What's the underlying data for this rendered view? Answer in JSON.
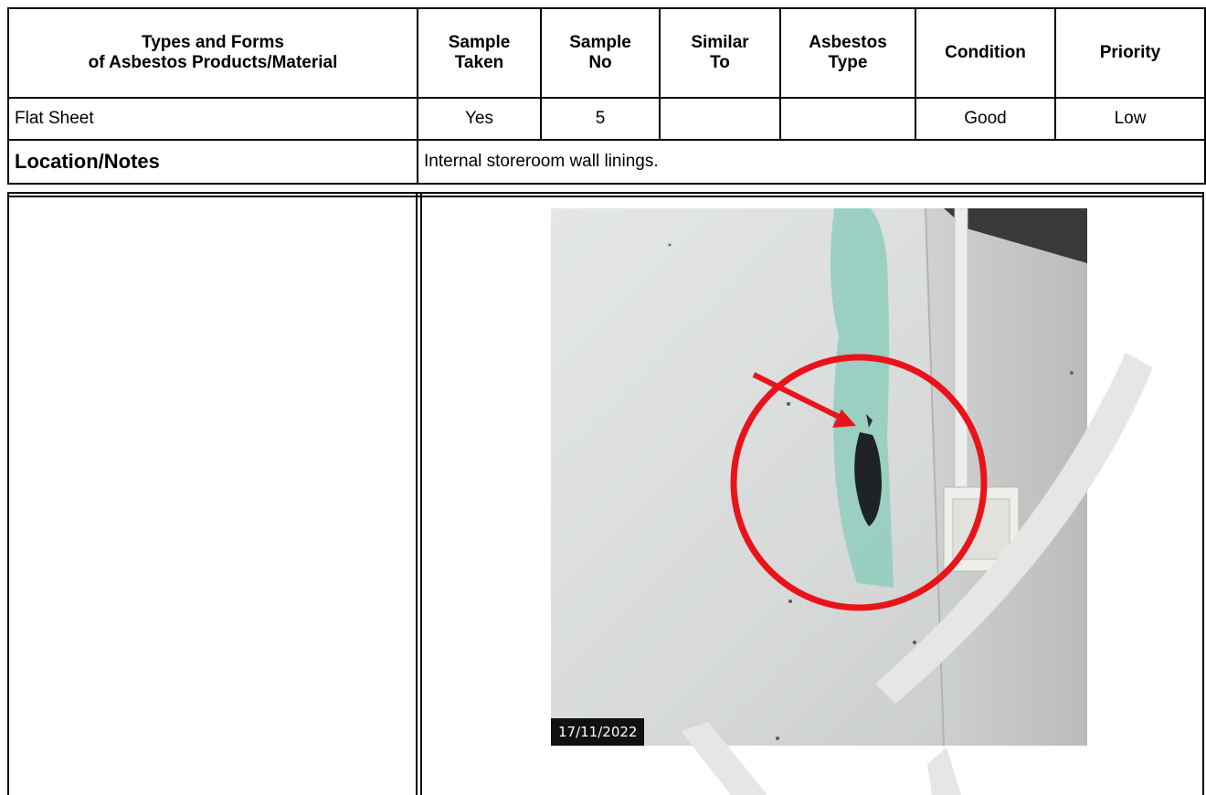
{
  "header": {
    "col_types": [
      "Types and Forms",
      "of Asbestos Products/Material"
    ],
    "col_sample_taken": [
      "Sample",
      "Taken"
    ],
    "col_sample_no": [
      "Sample",
      "No"
    ],
    "col_similar_to": [
      "Similar",
      "To"
    ],
    "col_asbestos_type": [
      "Asbestos",
      "Type"
    ],
    "col_condition": "Condition",
    "col_priority": "Priority"
  },
  "row": {
    "type": "Flat Sheet",
    "sample_taken": "Yes",
    "sample_no": "5",
    "similar_to": "",
    "asbestos_type": "",
    "condition": "Good",
    "priority": "Low"
  },
  "location": {
    "label": "Location/Notes",
    "notes": "Internal storeroom wall linings."
  },
  "photo": {
    "date_stamp": "17/11/2022",
    "annotation_color": "#e8141a",
    "wall_color": "#d9dcdb",
    "patch_color": "#8fcdbd"
  },
  "watermark_color": "#e6e6e6"
}
